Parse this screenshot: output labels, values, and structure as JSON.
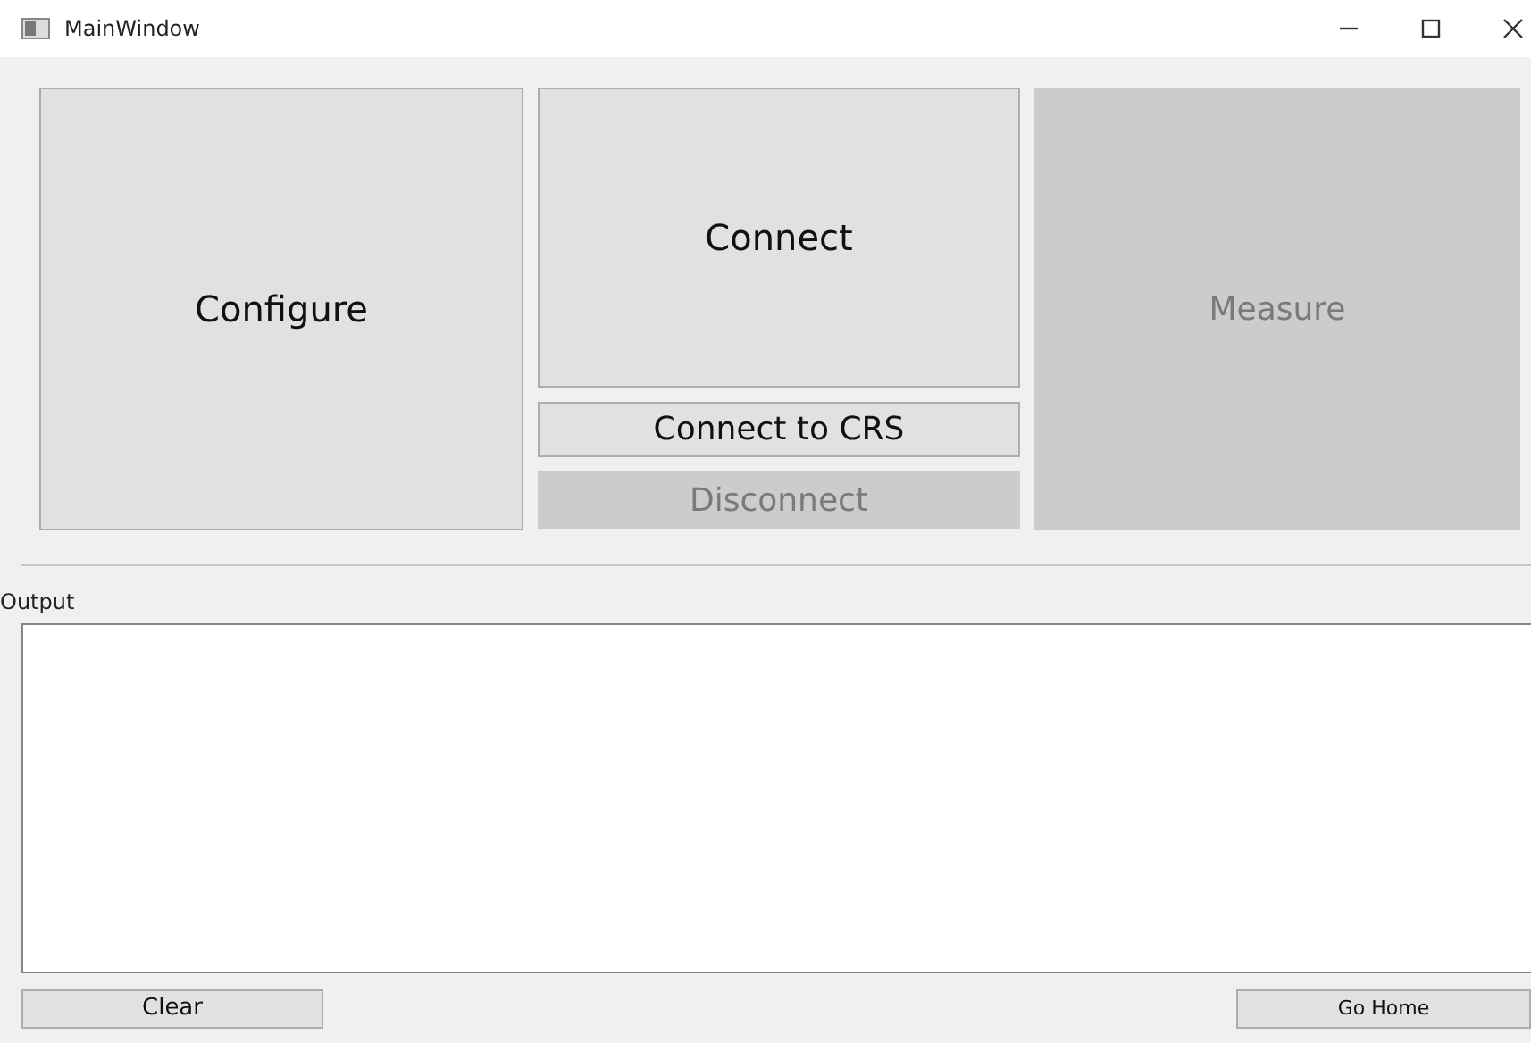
{
  "window": {
    "title": "MainWindow"
  },
  "buttons": [
    {
      "label": "Configure",
      "disabled": false
    },
    {
      "label": "Connect",
      "disabled": false
    },
    {
      "label": "Connect to CRS",
      "disabled": false
    },
    {
      "label": "Disconnect",
      "disabled": true
    },
    {
      "label": "Measure",
      "disabled": true
    }
  ],
  "output": {
    "label": "Output"
  },
  "bottom_buttons": [
    {
      "label": "Clear"
    },
    {
      "label": "Go Home"
    }
  ]
}
